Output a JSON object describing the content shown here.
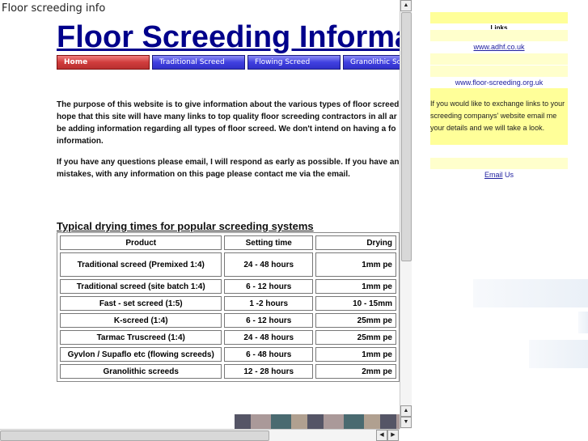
{
  "page_title": "Floor screeding info",
  "heading": "Floor Screeding Information Website",
  "nav": [
    {
      "label": "Home",
      "active": true
    },
    {
      "label": "Traditional Screed"
    },
    {
      "label": "Flowing Screed"
    },
    {
      "label": "Granolithic Screed"
    }
  ],
  "intro": [
    "The purpose of this website is to give information about the various types of floor screed",
    "hope that this site will have many links to top quality floor screeding contractors in all ar",
    "be adding information regarding all types of floor screed. We don't intend on having a fo",
    "information."
  ],
  "contact": [
    "If you have any questions please email, I will respond as early as possible. If you have an",
    "mistakes, with any information on this page please contact me via the email."
  ],
  "table": {
    "caption": "Typical drying times for popular screeding systems",
    "headers": [
      "Product",
      "Setting time",
      "Drying"
    ],
    "rows": [
      [
        "Traditional screed (Premixed 1:4)",
        "24 - 48 hours",
        "1mm pe"
      ],
      [
        "Traditional screed (site batch 1:4)",
        "6 - 12 hours",
        "1mm pe"
      ],
      [
        "Fast - set screed (1:5)",
        "1 -2 hours",
        "10 - 15mm"
      ],
      [
        "K-screed (1:4)",
        "6 - 12 hours",
        "25mm pe"
      ],
      [
        "Tarmac Truscreed (1:4)",
        "24 - 48 hours",
        "25mm pe"
      ],
      [
        "Gyvlon / Supaflo etc (flowing screeds)",
        "6 - 48 hours",
        "1mm pe"
      ],
      [
        "Granolithic screeds",
        "12 - 28 hours",
        "2mm pe"
      ]
    ]
  },
  "sidebar": {
    "links_title": "Links",
    "link1": "www.adhf.co.uk",
    "link2": "www.floor-screeding.org.uk",
    "exchange_text": "If you would like to exchange links to your screeding companys' website email me your details and we will take a look.",
    "email_link": "Email",
    "email_suffix": " Us"
  },
  "colors": {
    "heading": "#00008b",
    "nav": "#4040e0",
    "nav_active": "#d03c3c",
    "sidebar_yellow": "#ffff99"
  }
}
